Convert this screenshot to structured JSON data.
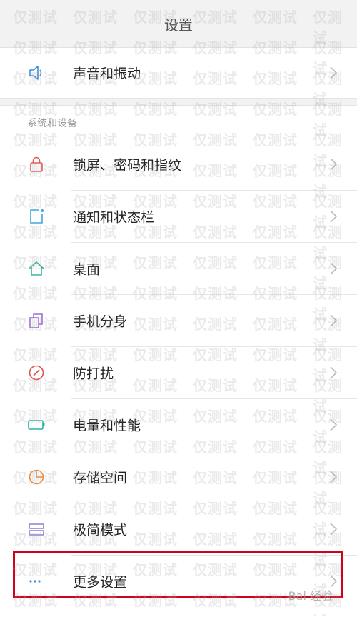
{
  "header": {
    "title": "设置"
  },
  "top_item": {
    "label": "声音和振动",
    "icon": "speaker-icon"
  },
  "section": {
    "title": "系统和设备"
  },
  "items": [
    {
      "label": "锁屏、密码和指纹",
      "icon": "lock-icon"
    },
    {
      "label": "通知和状态栏",
      "icon": "notification-icon"
    },
    {
      "label": "桌面",
      "icon": "home-icon"
    },
    {
      "label": "手机分身",
      "icon": "clone-icon"
    },
    {
      "label": "防打扰",
      "icon": "do-not-disturb-icon"
    },
    {
      "label": "电量和性能",
      "icon": "battery-icon"
    },
    {
      "label": "存储空间",
      "icon": "storage-pie-icon"
    },
    {
      "label": "极简模式",
      "icon": "simple-mode-icon"
    },
    {
      "label": "更多设置",
      "icon": "more-icon"
    }
  ],
  "watermark": {
    "text": "仅测试"
  },
  "brand": {
    "text": "Bai 经验"
  },
  "colors": {
    "highlight": "#d0021b",
    "speaker": "#3d8fd9",
    "lock": "#e05a5a",
    "notification": "#3fa7e0",
    "home": "#3ab5a0",
    "clone": "#9b6fd6",
    "dnd": "#e0504a",
    "battery": "#2fb3a5",
    "storage": "#f08a3c",
    "simple": "#8c7fd6",
    "more": "#3d8fd9"
  }
}
